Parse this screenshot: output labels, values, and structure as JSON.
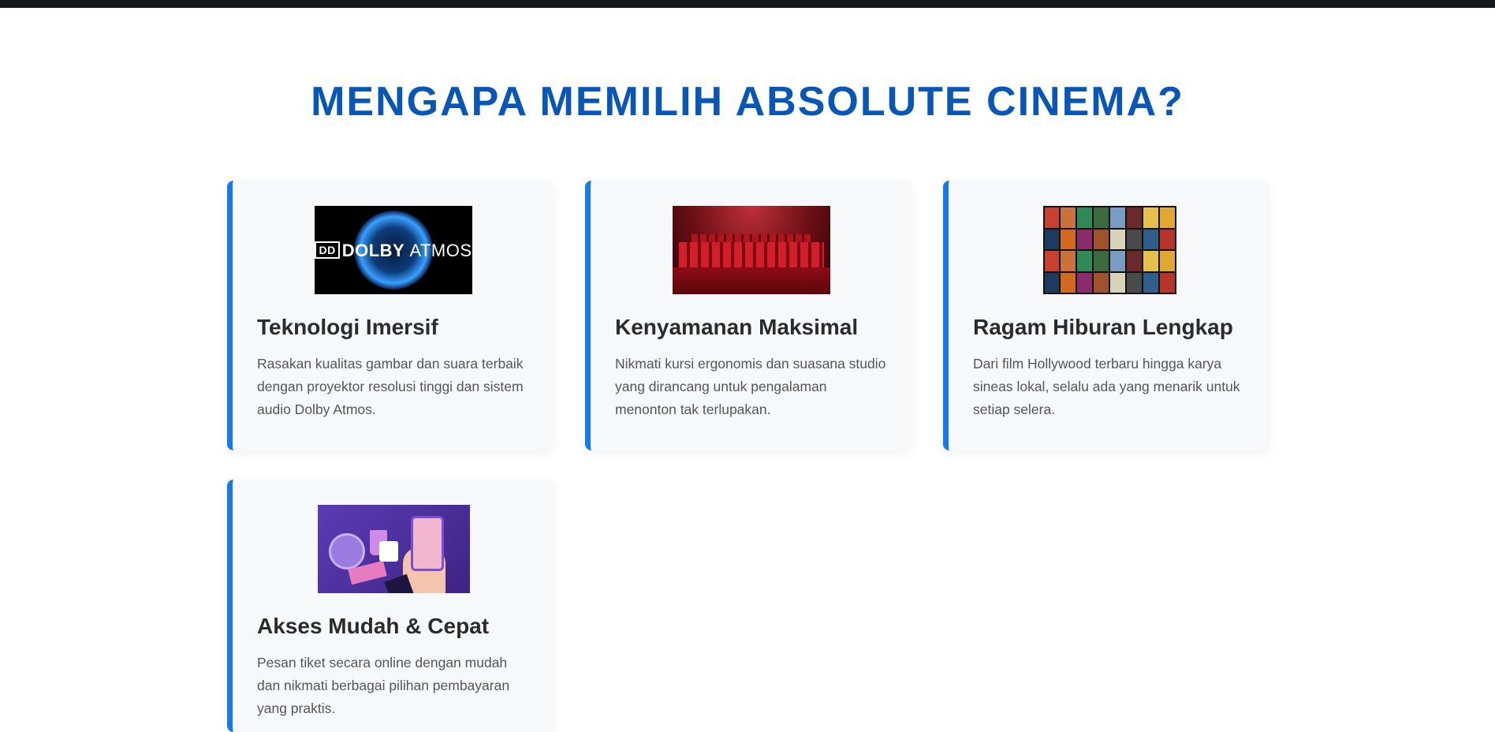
{
  "section": {
    "title": "MENGAPA MEMILIH ABSOLUTE CINEMA?"
  },
  "features": [
    {
      "title": "Teknologi Imersif",
      "description": "Rasakan kualitas gambar dan suara terbaik dengan proyektor resolusi tinggi dan sistem audio Dolby Atmos.",
      "image": "dolby-atmos-logo",
      "image_text": {
        "brand": "DOLBY",
        "product": "ATMOS"
      }
    },
    {
      "title": "Kenyamanan Maksimal",
      "description": "Nikmati kursi ergonomis dan suasana studio yang dirancang untuk pengalaman menonton tak terlupakan.",
      "image": "red-theater-seats"
    },
    {
      "title": "Ragam Hiburan Lengkap",
      "description": "Dari film Hollywood terbaru hingga karya sineas lokal, selalu ada yang menarik untuk setiap selera.",
      "image": "movie-posters-collage"
    },
    {
      "title": "Akses Mudah & Cepat",
      "description": "Pesan tiket secara online dengan mudah dan nikmati berbagai pilihan pembayaran yang praktis.",
      "image": "online-ticket-illustration"
    }
  ],
  "colors": {
    "title": "#0756b8",
    "card_accent": "#1779f0",
    "card_bg": "#f7f8fa",
    "topbar": "#15181c"
  }
}
